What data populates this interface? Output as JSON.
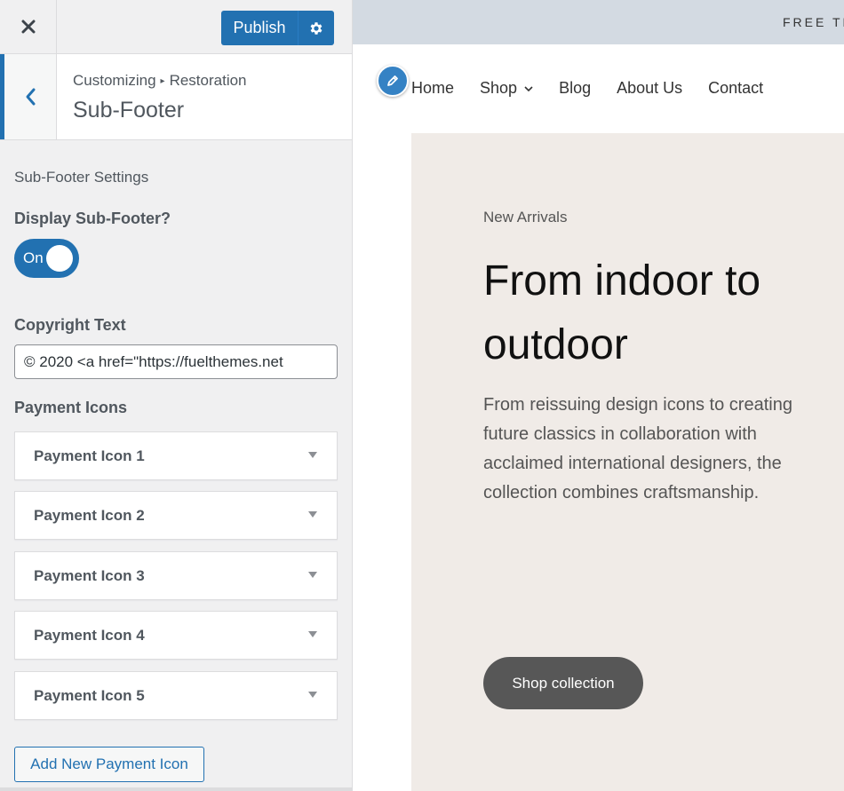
{
  "customizer": {
    "publish_label": "Publish",
    "breadcrumb_root": "Customizing",
    "breadcrumb_separator": "▸",
    "breadcrumb_current": "Restoration",
    "section_title": "Sub-Footer",
    "subsection_title": "Sub-Footer Settings",
    "display_label": "Display Sub-Footer?",
    "toggle_state": "On",
    "copyright_label": "Copyright Text",
    "copyright_value": "© 2020 <a href=\"https://fuelthemes.net",
    "payment_label": "Payment Icons",
    "payment_icons": [
      {
        "label": "Payment Icon 1"
      },
      {
        "label": "Payment Icon 2"
      },
      {
        "label": "Payment Icon 3"
      },
      {
        "label": "Payment Icon 4"
      },
      {
        "label": "Payment Icon 5"
      }
    ],
    "add_button_label": "Add New Payment Icon",
    "accent_color": "#2271b1"
  },
  "preview": {
    "announcement": "FREE TR",
    "nav": [
      {
        "label": "Home"
      },
      {
        "label": "Shop",
        "has_dropdown": true
      },
      {
        "label": "Blog"
      },
      {
        "label": "About Us"
      },
      {
        "label": "Contact"
      }
    ],
    "hero": {
      "eyebrow": "New Arrivals",
      "headline": "From indoor to outdoor",
      "description": "From reissuing design icons to creating future classics in collaboration with acclaimed international designers, the collection combines craftsmanship.",
      "cta_label": "Shop collection",
      "background_color": "#f0ebe7"
    }
  }
}
